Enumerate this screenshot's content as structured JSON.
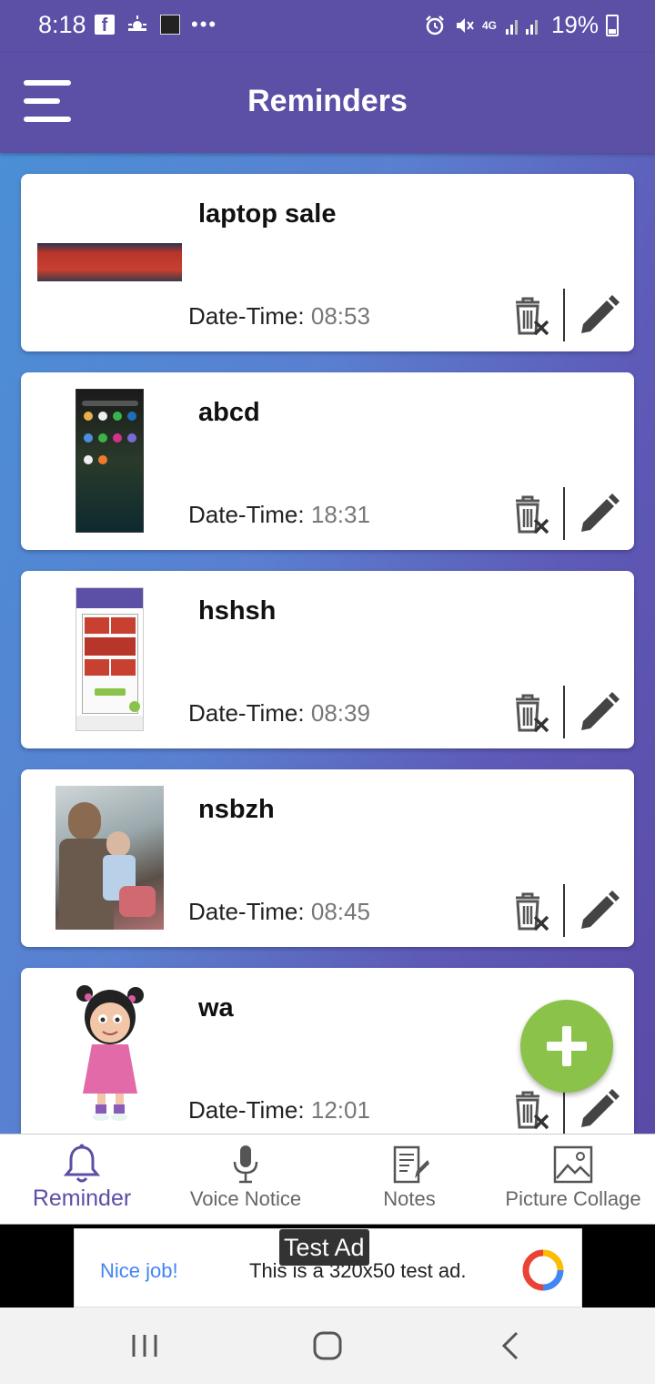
{
  "status_bar": {
    "time": "8:18",
    "facebook_glyph": "f",
    "battery": "19%",
    "network": "4G",
    "icons_left": [
      "facebook-icon",
      "weather-icon",
      "app-icon",
      "more-dots-icon"
    ],
    "icons_right": [
      "alarm-icon",
      "mute-icon",
      "signal-icon",
      "battery-icon"
    ]
  },
  "app_bar": {
    "title": "Reminders",
    "menu_icon": "hamburger-menu-icon"
  },
  "reminders": [
    {
      "title": "laptop sale",
      "datetime_label": "Date-Time:",
      "time": "08:53"
    },
    {
      "title": "abcd",
      "datetime_label": "Date-Time:",
      "time": "18:31"
    },
    {
      "title": "hshsh",
      "datetime_label": "Date-Time:",
      "time": "08:39"
    },
    {
      "title": "nsbzh",
      "datetime_label": "Date-Time:",
      "time": "08:45"
    },
    {
      "title": "wa",
      "datetime_label": "Date-Time:",
      "time": "12:01"
    }
  ],
  "bottom_nav": {
    "items": [
      {
        "label": "Reminder",
        "icon": "bell-icon",
        "active": true
      },
      {
        "label": "Voice Notice",
        "icon": "microphone-icon",
        "active": false
      },
      {
        "label": "Notes",
        "icon": "notes-icon",
        "active": false
      },
      {
        "label": "Picture Collage",
        "icon": "image-icon",
        "active": false
      }
    ]
  },
  "ad": {
    "label": "Test Ad",
    "headline": "Nice job!",
    "body": "This is a 320x50 test ad."
  },
  "colors": {
    "primary": "#5b4fa6",
    "fab": "#8bc34a",
    "card": "#ffffff"
  }
}
